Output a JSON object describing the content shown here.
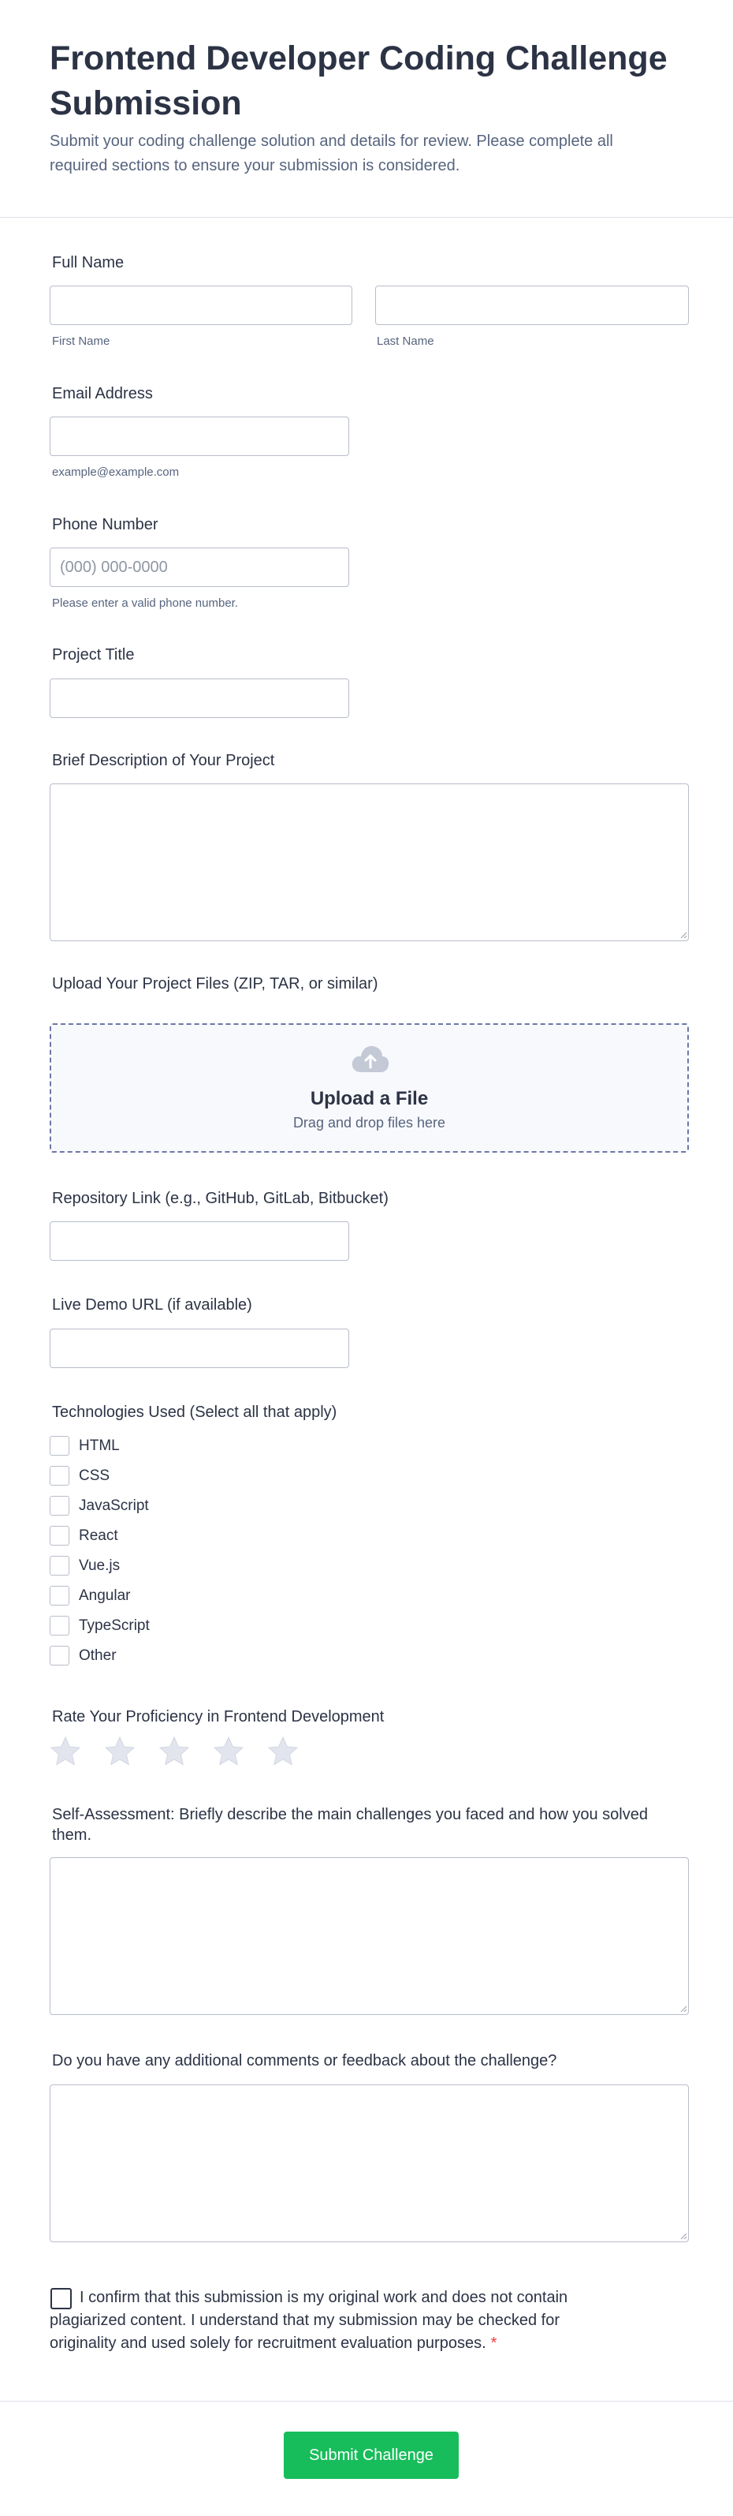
{
  "header": {
    "title": "Frontend Developer Coding Challenge Submission",
    "subtitle": "Submit your coding challenge solution and details for review. Please complete all required sections to ensure your submission is considered."
  },
  "fields": {
    "full_name": {
      "label": "Full Name",
      "first_sublabel": "First Name",
      "last_sublabel": "Last Name"
    },
    "email": {
      "label": "Email Address",
      "sublabel": "example@example.com"
    },
    "phone": {
      "label": "Phone Number",
      "placeholder": "(000) 000-0000",
      "sublabel": "Please enter a valid phone number."
    },
    "project_title": {
      "label": "Project Title"
    },
    "description": {
      "label": "Brief Description of Your Project"
    },
    "upload": {
      "label": "Upload Your Project Files (ZIP, TAR, or similar)",
      "title": "Upload a File",
      "subtitle": "Drag and drop files here"
    },
    "repo": {
      "label": "Repository Link (e.g., GitHub, GitLab, Bitbucket)"
    },
    "demo": {
      "label": "Live Demo URL (if available)"
    },
    "technologies": {
      "label": "Technologies Used (Select all that apply)",
      "options": [
        "HTML",
        "CSS",
        "JavaScript",
        "React",
        "Vue.js",
        "Angular",
        "TypeScript",
        "Other"
      ]
    },
    "rating": {
      "label": "Rate Your Proficiency in Frontend Development",
      "max": 5,
      "value": 0
    },
    "self_assessment": {
      "label": "Self-Assessment: Briefly describe the main challenges you faced and how you solved them."
    },
    "comments": {
      "label": "Do you have any additional comments or feedback about the challenge?"
    },
    "confirm": {
      "text": "I confirm that this submission is my original work and does not contain plagiarized content. I understand that my submission may be checked for originality and used solely for recruitment evaluation purposes.",
      "required_mark": "*"
    }
  },
  "submit_label": "Submit Challenge",
  "colors": {
    "accent": "#18bd5b",
    "required": "#f23a3c",
    "text": "#2c3345",
    "muted": "#57647e",
    "star": "#e3e5ee"
  },
  "icons": {
    "upload": "cloud-upload-icon",
    "star": "star-icon"
  }
}
